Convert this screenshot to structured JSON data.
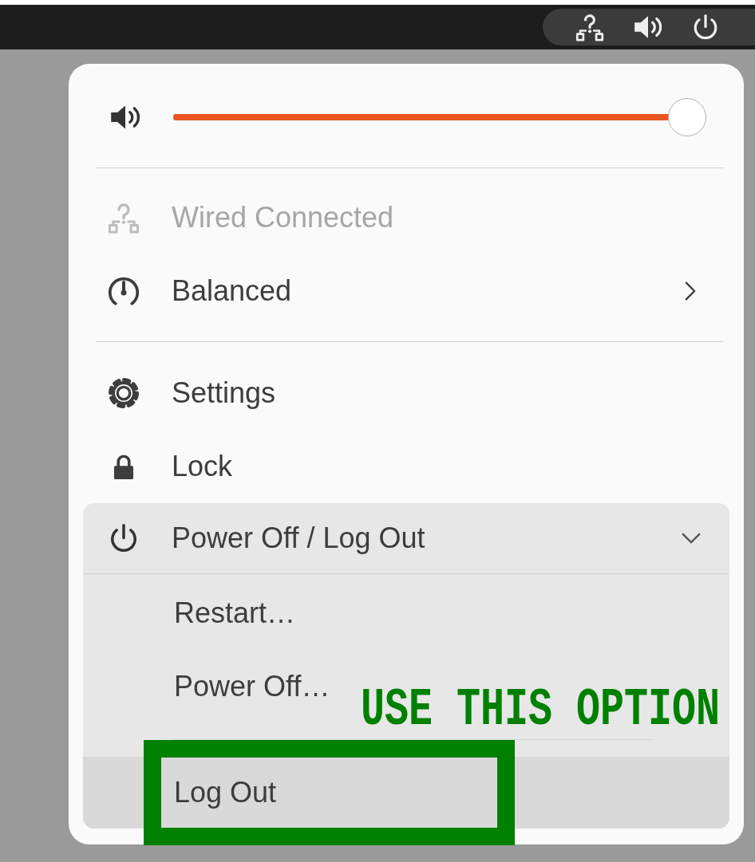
{
  "top_bar": {
    "status_menu_open": true
  },
  "menu": {
    "volume": {
      "level": 1
    },
    "items": [
      {
        "kind": "network",
        "label": "Wired Connected",
        "disabled": true,
        "submenu": false
      },
      {
        "kind": "powermode",
        "label": "Balanced",
        "disabled": false,
        "submenu": true
      },
      {
        "kind": "separator"
      },
      {
        "kind": "settings",
        "label": "Settings",
        "disabled": false,
        "submenu": false
      },
      {
        "kind": "lock",
        "label": "Lock",
        "disabled": false,
        "submenu": false
      }
    ],
    "power_menu": {
      "label": "Power Off / Log Out",
      "expanded": true,
      "items": [
        {
          "kind": "action",
          "label": "Restart…",
          "selected": false
        },
        {
          "kind": "action",
          "label": "Power Off…",
          "selected": false
        },
        {
          "kind": "separator"
        },
        {
          "kind": "action",
          "label": "Log Out",
          "selected": true
        }
      ]
    }
  },
  "annotation": {
    "label": "USE THIS OPTION"
  }
}
